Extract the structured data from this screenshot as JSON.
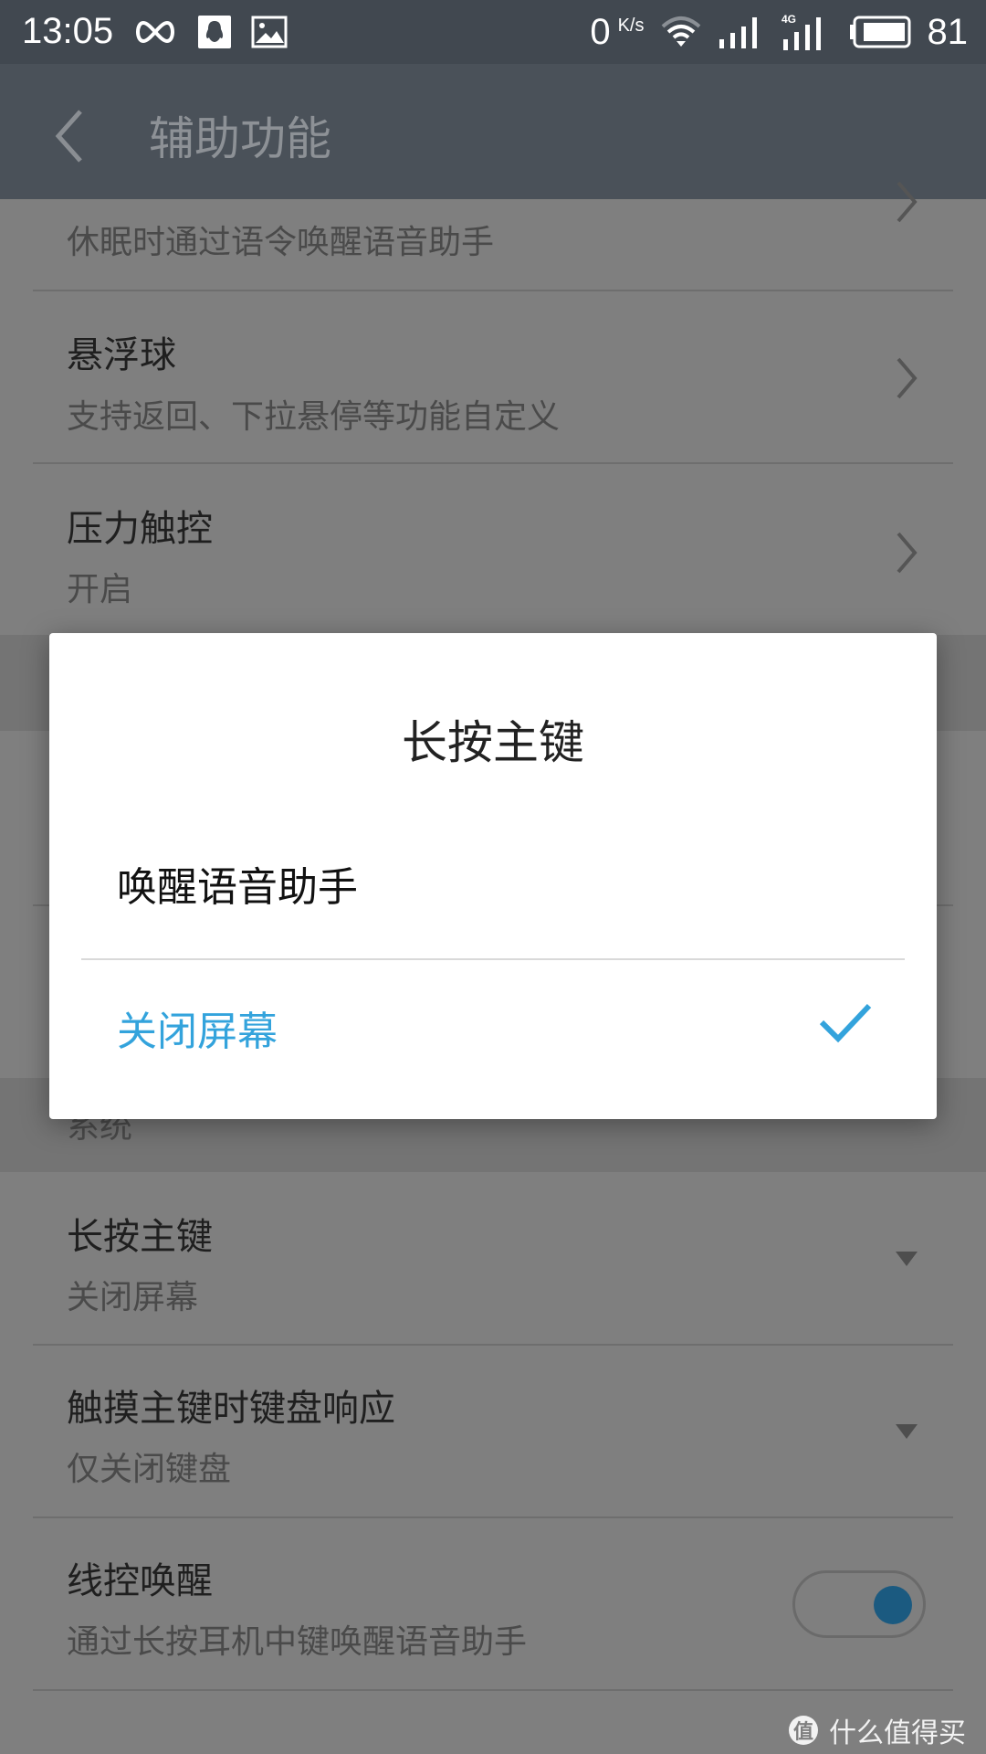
{
  "status_bar": {
    "time": "13:05",
    "left_icons": [
      "infinity-icon",
      "qq-icon",
      "image-icon"
    ],
    "net_speed_value": "0",
    "net_speed_unit": "K/s",
    "network_type": "4G",
    "battery_percent": "81"
  },
  "header": {
    "back_icon": "chevron-left-icon",
    "title": "辅助功能"
  },
  "list": {
    "items": [
      {
        "title": "",
        "subtitle": "休眠时通过语令唤醒语音助手",
        "control": "chevron-right"
      },
      {
        "title": "悬浮球",
        "subtitle": "支持返回、下拉悬停等功能自定义",
        "control": "chevron-right"
      },
      {
        "title": "压力触控",
        "subtitle": "开启",
        "control": "chevron-right"
      }
    ],
    "section_system": "系统",
    "system_items": [
      {
        "title": "长按主键",
        "subtitle": "关闭屏幕",
        "control": "dropdown"
      },
      {
        "title": "触摸主键时键盘响应",
        "subtitle": "仅关闭键盘",
        "control": "dropdown"
      },
      {
        "title": "线控唤醒",
        "subtitle": "通过长按耳机中键唤醒语音助手",
        "control": "toggle",
        "toggle_on": true
      }
    ]
  },
  "dialog": {
    "title": "长按主键",
    "options": [
      {
        "label": "唤醒语音助手",
        "selected": false
      },
      {
        "label": "关闭屏幕",
        "selected": true
      }
    ],
    "accent_color": "#33a3dc"
  },
  "watermark": {
    "logo_char": "值",
    "text": "什么值得买"
  }
}
